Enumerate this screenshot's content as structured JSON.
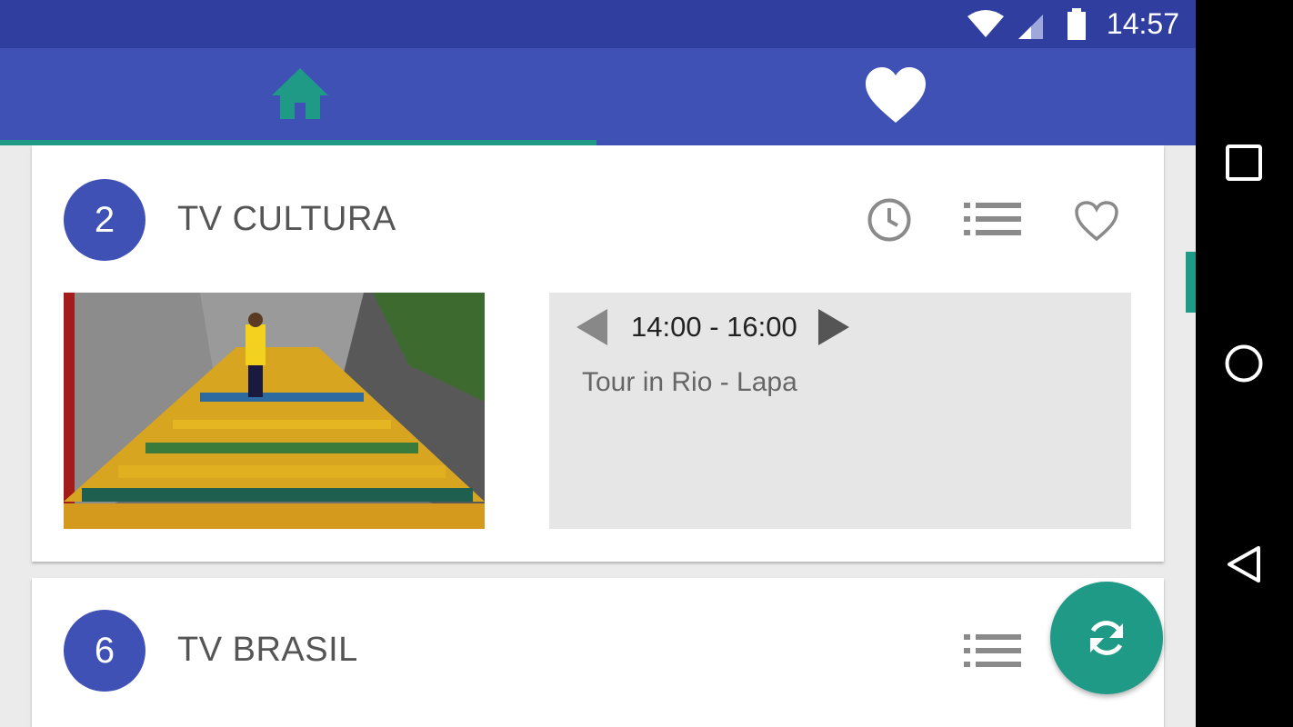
{
  "status_bar": {
    "time": "14:57",
    "icons": [
      "wifi-icon",
      "cell-signal-icon",
      "battery-icon"
    ]
  },
  "tabs": [
    {
      "name": "home",
      "icon": "home-icon",
      "color": "#1e9a86",
      "selected": true
    },
    {
      "name": "favorites",
      "icon": "heart-icon",
      "color": "#ffffff",
      "selected": false
    }
  ],
  "channels": [
    {
      "number": "2",
      "name": "TV CULTURA",
      "icons": [
        "clock-icon",
        "list-icon",
        "heart-outline-icon"
      ],
      "program": {
        "time": "14:00 - 16:00",
        "title": "Tour in Rio - Lapa"
      }
    },
    {
      "number": "6",
      "name": "TV BRASIL",
      "icons": [
        "list-icon"
      ]
    }
  ],
  "fab": {
    "icon": "refresh-icon"
  },
  "nav_bar": {
    "icons": [
      "recents-square-icon",
      "home-circle-icon",
      "back-triangle-icon"
    ]
  },
  "colors": {
    "primary": "#3f51b5",
    "primary_dark": "#303f9f",
    "accent": "#1e9a86"
  }
}
